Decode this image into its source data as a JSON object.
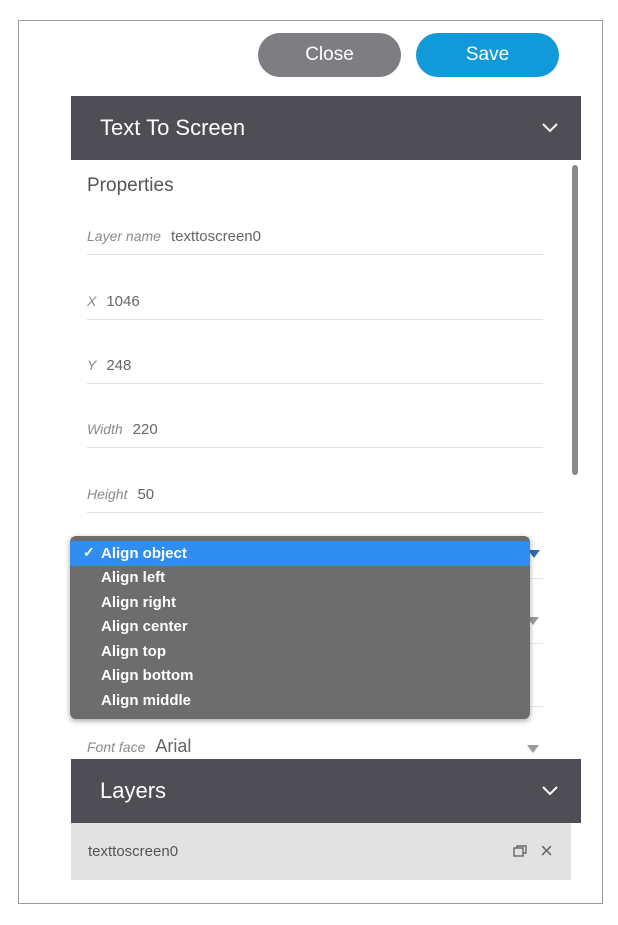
{
  "toolbar": {
    "close_label": "Close",
    "save_label": "Save"
  },
  "properties_panel": {
    "header": "Text To Screen",
    "title": "Properties",
    "fields": [
      {
        "label": "Layer name",
        "value": "texttoscreen0"
      },
      {
        "label": "X",
        "value": "1046"
      },
      {
        "label": "Y",
        "value": "248"
      },
      {
        "label": "Width",
        "value": "220"
      },
      {
        "label": "Height",
        "value": "50"
      }
    ],
    "font_face": {
      "label": "Font face",
      "value": "Arial"
    }
  },
  "align_dropdown": {
    "options": [
      "Align object",
      "Align left",
      "Align right",
      "Align center",
      "Align top",
      "Align bottom",
      "Align middle"
    ],
    "selected": "Align object"
  },
  "layers_panel": {
    "header": "Layers",
    "items": [
      {
        "name": "texttoscreen0"
      }
    ]
  },
  "colors": {
    "accent": "#109ad9",
    "header_bg": "#4e4e54",
    "selected": "#2f8ef0"
  }
}
